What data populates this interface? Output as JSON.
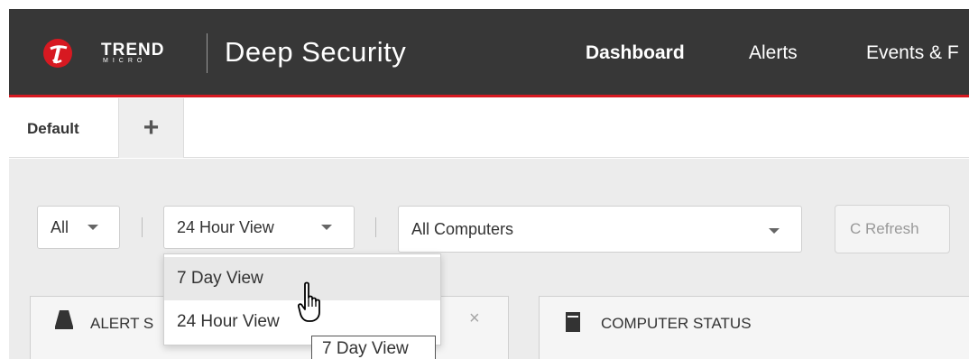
{
  "header": {
    "brand_top": "TREND",
    "brand_bottom": "MICRO",
    "product": "Deep Security",
    "nav": [
      "Dashboard",
      "Alerts",
      "Events & F"
    ],
    "colors": {
      "bar": "#373737",
      "accent": "#d71921"
    }
  },
  "tabs": {
    "active_label": "Default",
    "add_icon": "plus-icon",
    "add_symbol": "+"
  },
  "filters": {
    "scope": "All",
    "time_view": "24 Hour View",
    "computers": "All Computers",
    "refresh_icon": "refresh-icon",
    "refresh_symbol": "C",
    "refresh_label": "Refresh"
  },
  "dropdown": {
    "options": [
      "7 Day View",
      "24 Hour View"
    ],
    "hovered": "7 Day View"
  },
  "tooltip": "7 Day View",
  "widgets": {
    "alert_title": "ALERT S",
    "alert_icon": "alert-icon",
    "alert_close": "×",
    "computer_title": "COMPUTER STATUS",
    "computer_icon": "computer-icon"
  }
}
